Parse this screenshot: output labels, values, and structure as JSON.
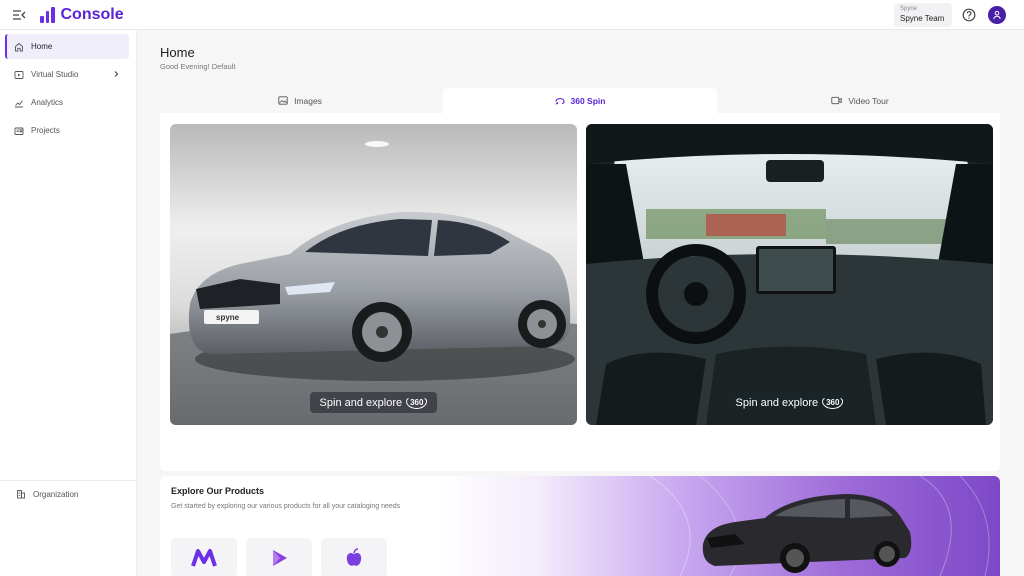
{
  "app": {
    "title": "Console"
  },
  "user": {
    "org_small": "Spyne",
    "team_name": "Spyne Team"
  },
  "sidebar": {
    "items": [
      {
        "label": "Home",
        "icon": "home-icon"
      },
      {
        "label": "Virtual Studio",
        "icon": "studio-icon"
      },
      {
        "label": "Analytics",
        "icon": "analytics-icon"
      },
      {
        "label": "Projects",
        "icon": "projects-icon"
      }
    ],
    "org": {
      "label": "Organization",
      "icon": "building-icon"
    }
  },
  "page": {
    "title": "Home",
    "subtitle": "Good Evening! Default"
  },
  "tabs": [
    {
      "label": "Images",
      "icon": "image-icon"
    },
    {
      "label": "360 Spin",
      "icon": "spin-icon"
    },
    {
      "label": "Video Tour",
      "icon": "video-icon"
    }
  ],
  "cards": [
    {
      "label": "Spin and explore",
      "badge": "360",
      "plate": "spyne"
    },
    {
      "label": "Spin and explore",
      "badge": "360"
    }
  ],
  "explore": {
    "title": "Explore Our Products",
    "subtitle": "Get started by exploring our various products for all your cataloging needs"
  },
  "colors": {
    "brand": "#5b22d6",
    "avatar": "#4a1fa8"
  }
}
